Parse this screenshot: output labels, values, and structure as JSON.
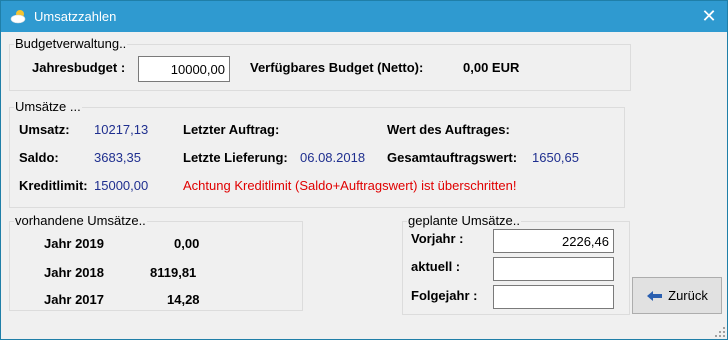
{
  "window": {
    "title": "Umsatzzahlen",
    "close_glyph": "✕"
  },
  "budget": {
    "group_label": "Budgetverwaltung..",
    "jahresbudget_label": "Jahresbudget :",
    "jahresbudget_value": "10000,00",
    "verfuegbar_label": "Verfügbares Budget (Netto):",
    "verfuegbar_value": "0,00 EUR"
  },
  "umsaetze": {
    "group_label": "Umsätze ...",
    "umsatz_label": "Umsatz:",
    "umsatz_value": "10217,13",
    "saldo_label": "Saldo:",
    "saldo_value": "3683,35",
    "kreditlimit_label": "Kreditlimit:",
    "kreditlimit_value": "15000,00",
    "letzter_auftrag_label": "Letzter Auftrag:",
    "letzte_lieferung_label": "Letzte Lieferung:",
    "letzte_lieferung_value": "06.08.2018",
    "wert_auftrag_label": "Wert des Auftrages:",
    "gesamtauftragswert_label": "Gesamtauftragswert:",
    "gesamtauftragswert_value": "1650,65",
    "warning": "Achtung Kreditlimit (Saldo+Auftragswert) ist überschritten!"
  },
  "vorhandene": {
    "group_label": "vorhandene Umsätze..",
    "rows": [
      {
        "year": "Jahr 2019",
        "value": "0,00"
      },
      {
        "year": "Jahr 2018",
        "value": "8119,81"
      },
      {
        "year": "Jahr 2017",
        "value": "14,28"
      }
    ]
  },
  "geplante": {
    "group_label": "geplante Umsätze..",
    "vorjahr_label": "Vorjahr :",
    "vorjahr_value": "2226,46",
    "aktuell_label": "aktuell :",
    "aktuell_value": "",
    "folgejahr_label": "Folgejahr :",
    "folgejahr_value": ""
  },
  "buttons": {
    "zurueck_label": "Zurück"
  },
  "colors": {
    "titlebar": "#2f9ad0",
    "value_text": "#1f2f8f",
    "warning_text": "#e00000"
  },
  "icons": {
    "app": "cloud-sun-icon",
    "close": "close-icon",
    "back": "back-arrow-icon"
  }
}
